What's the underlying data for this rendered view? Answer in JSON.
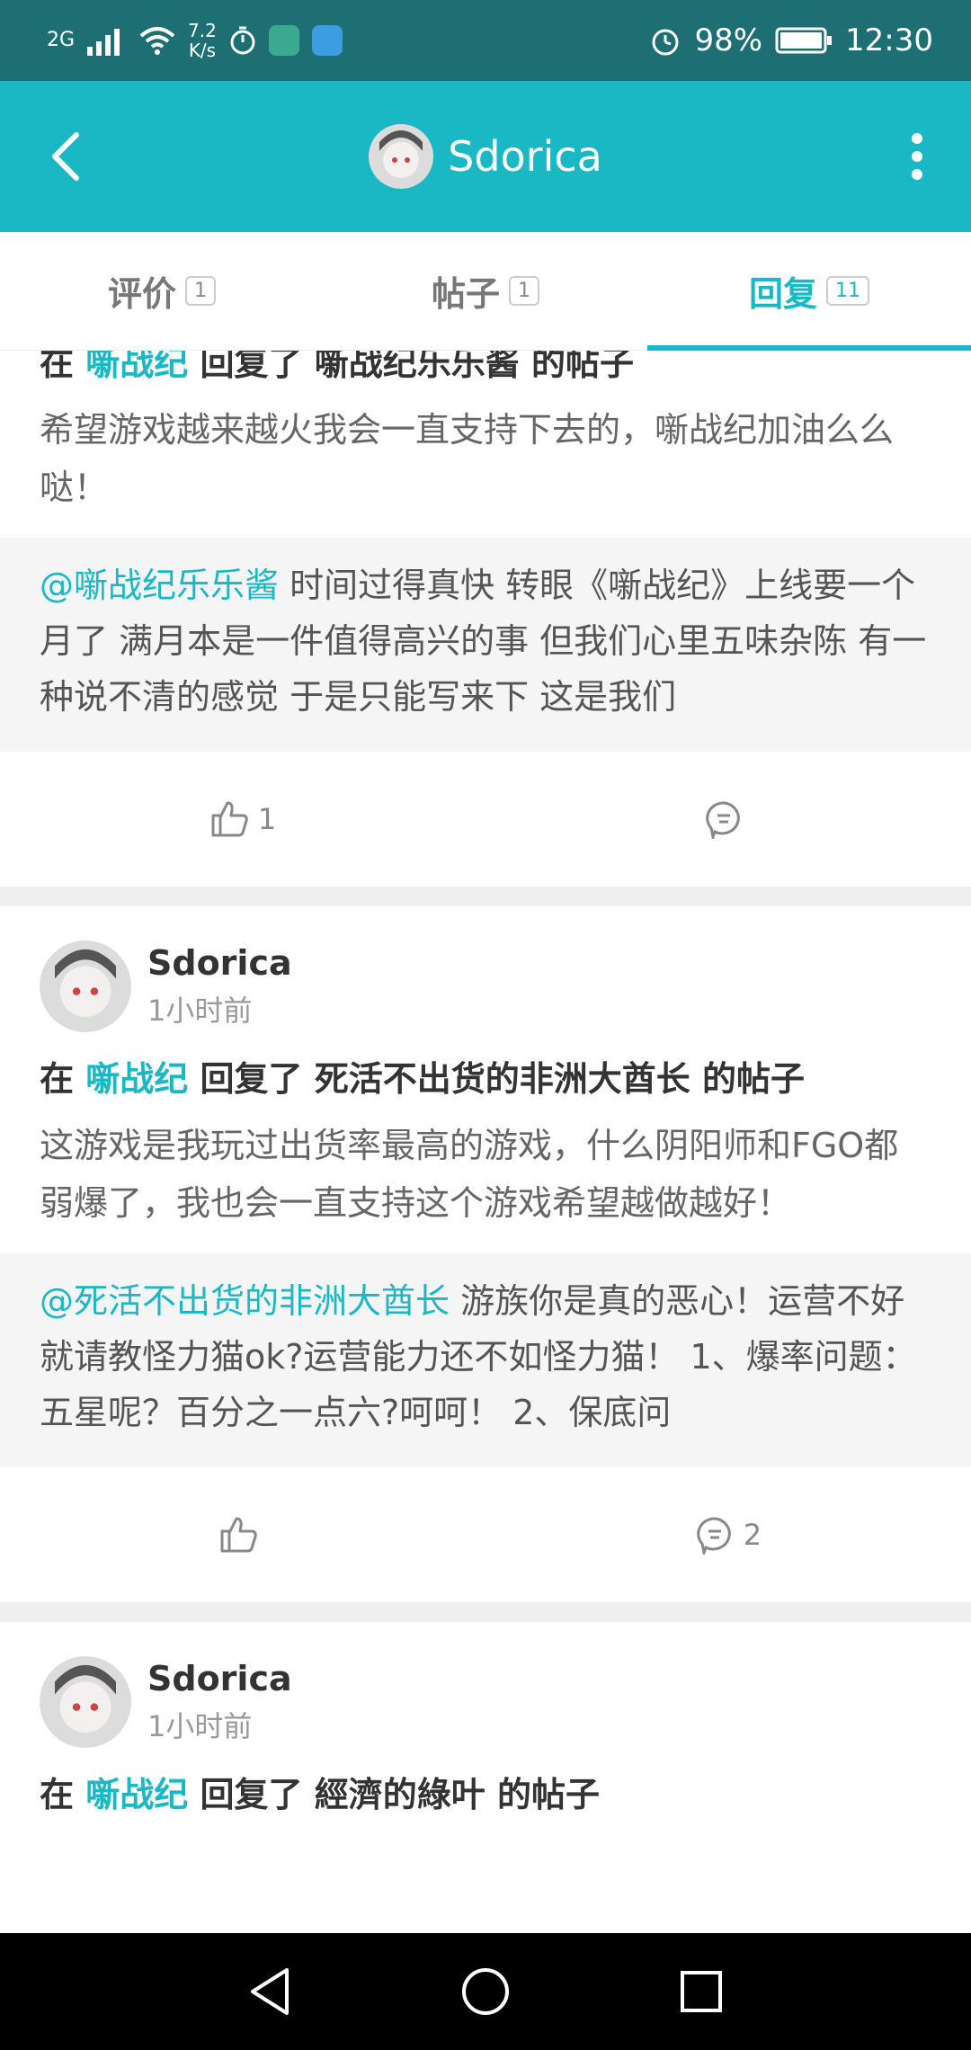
{
  "status_bar": {
    "network": "2G",
    "speed_value": "7.2",
    "speed_unit": "K/s",
    "battery": "98%",
    "time": "12:30"
  },
  "app_bar": {
    "title": "Sdorica"
  },
  "tabs": [
    {
      "label": "评价",
      "count": "1",
      "active": false
    },
    {
      "label": "帖子",
      "count": "1",
      "active": false
    },
    {
      "label": "回复",
      "count": "11",
      "active": true
    }
  ],
  "feed": {
    "item1": {
      "headline_pre": "在",
      "headline_game": "噺战纪",
      "headline_mid": "回复了",
      "headline_target": "噺战纪乐乐酱",
      "headline_suffix": "的帖子",
      "body": "希望游戏越来越火我会一直支持下去的，噺战纪加油么么哒！",
      "quote_mention": "@噺战纪乐乐酱",
      "quote_text": " 时间过得真快 转眼《噺战纪》上线要一个月了 满月本是一件值得高兴的事 但我们心里五味杂陈 有一种说不清的感觉 于是只能写来下  这是我们",
      "likes": "1",
      "comments": ""
    },
    "item2": {
      "user": "Sdorica",
      "time": "1小时前",
      "headline_pre": "在",
      "headline_game": "噺战纪",
      "headline_mid": "回复了",
      "headline_target": "死活不出货的非洲大酋长",
      "headline_suffix": "的帖子",
      "body": "这游戏是我玩过出货率最高的游戏，什么阴阳师和FGO都弱爆了，我也会一直支持这个游戏希望越做越好！",
      "quote_mention": "@死活不出货的非洲大酋长",
      "quote_text": " 游族你是真的恶心！运营不好就请教怪力猫ok?运营能力还不如怪力猫！ 1、爆率问题：五星呢？百分之一点六?呵呵！ 2、保底问",
      "likes": "",
      "comments": "2"
    },
    "item3": {
      "user": "Sdorica",
      "time": "1小时前",
      "headline_pre": "在",
      "headline_game": "噺战纪",
      "headline_mid": "回复了",
      "headline_target": "經濟的綠叶",
      "headline_suffix": "的帖子"
    }
  },
  "colors": {
    "accent": "#19b8c4",
    "status_bar": "#1e6f73"
  },
  "icons": {
    "back": "chevron-left-icon",
    "more": "more-vertical-icon",
    "like": "thumbs-up-icon",
    "comment": "comment-icon"
  }
}
